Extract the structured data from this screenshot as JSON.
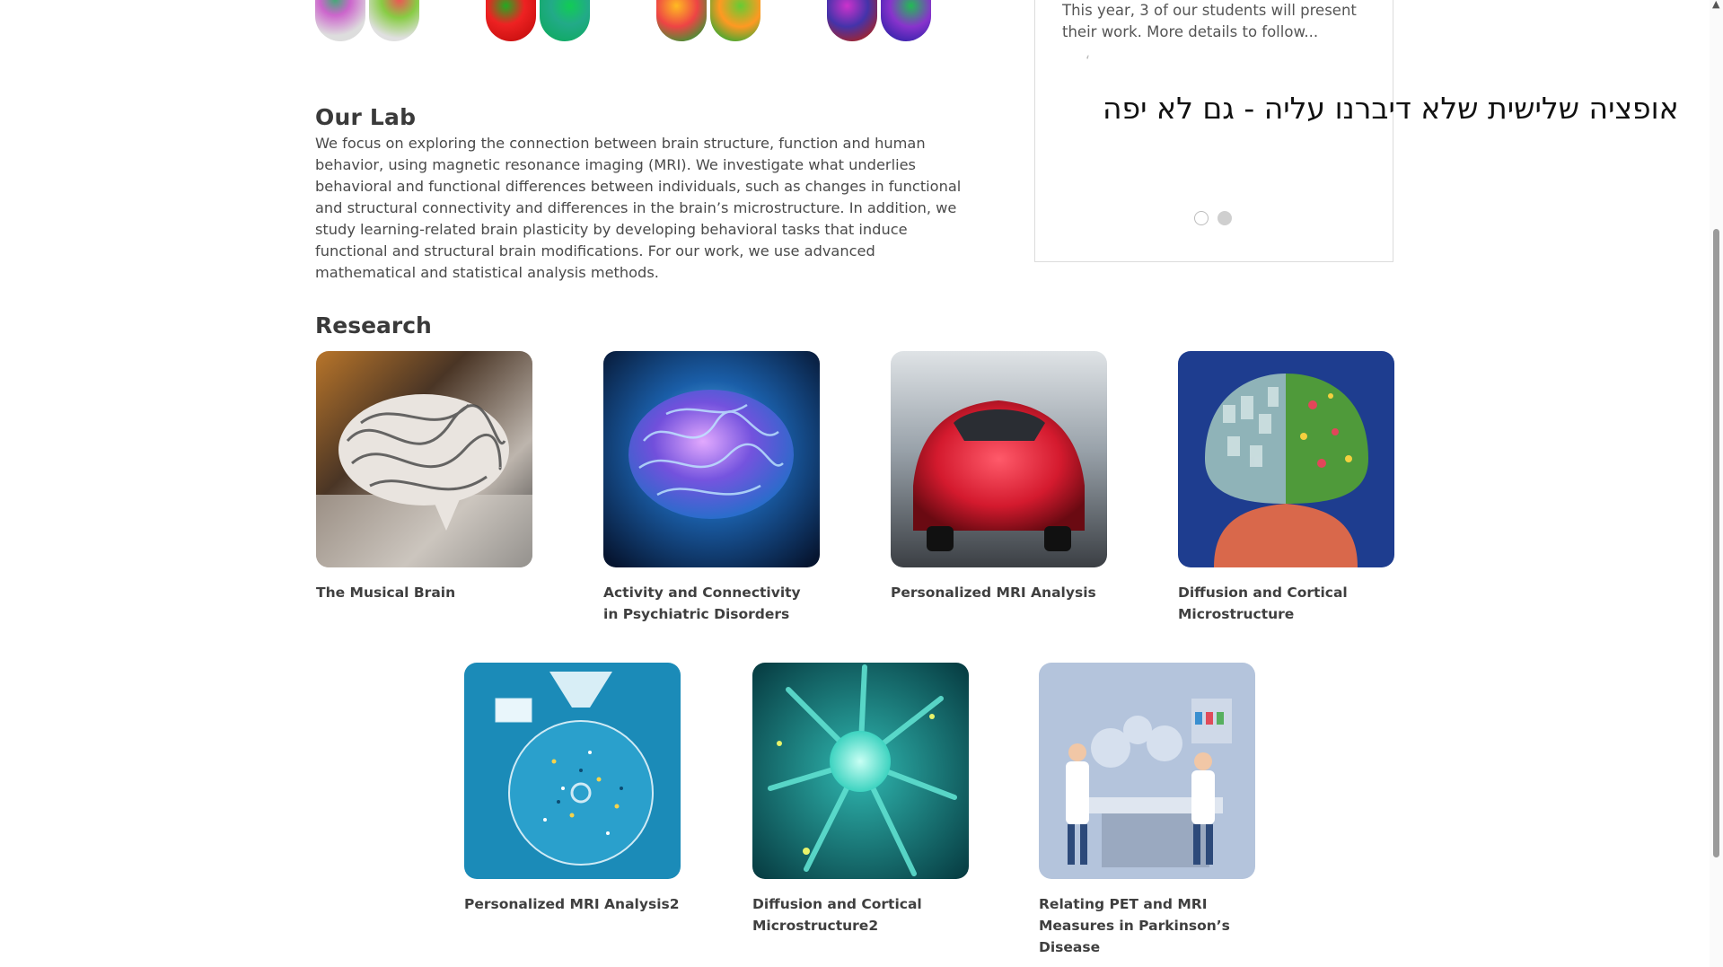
{
  "lab": {
    "title": "Our Lab",
    "description": "We focus on exploring the connection between brain structure, function and human behavior, using magnetic resonance imaging (MRI). We investigate what underlies behavioral and functional differences between individuals, such as changes in functional and structural connectivity and differences in the brain’s microstructure. In addition, we study learning-related brain plasticity by developing behavioral tasks that induce functional and structural brain modifications. For our work, we use advanced mathematical and statistical analysis methods."
  },
  "news": {
    "text": "This year, 3 of our students will present their work. More details to follow...",
    "quote_mark": "‘",
    "active_slide": 2,
    "slide_count": 2
  },
  "overflow_text": "אופציה שלישית שלא דיברנו עליה - גם לא יפה",
  "research": {
    "title": "Research",
    "cards": [
      {
        "label": "The Musical Brain",
        "image": "sheet-music-brain"
      },
      {
        "label": "Activity and Connectivity in Psychiatric Disorders",
        "image": "glowing-blue-brain"
      },
      {
        "label": "Personalized MRI Analysis",
        "image": "red-sports-car"
      },
      {
        "label": "Diffusion and Cortical Microstructure",
        "image": "split-brain-city-garden"
      },
      {
        "label": "Personalized MRI Analysis2",
        "image": "data-funnel-illustration"
      },
      {
        "label": "Diffusion and Cortical Microstructure2",
        "image": "cyan-neuron"
      },
      {
        "label": "Relating PET and MRI Measures in Parkinson’s Disease",
        "image": "lab-scientists-illustration"
      }
    ]
  },
  "colors": {
    "heading": "#3a3a3a",
    "body_text": "#4a4a4a",
    "panel_border": "#dcdcdc"
  }
}
